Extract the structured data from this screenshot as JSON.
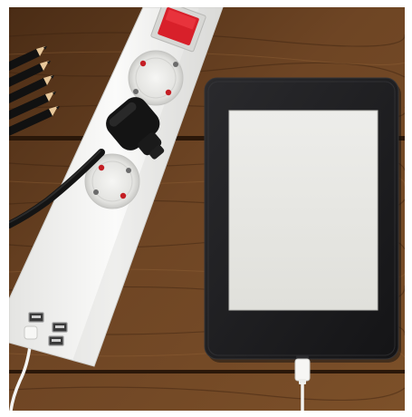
{
  "scene": {
    "subject": "photo",
    "colors": {
      "wood_dark": "#3d2412",
      "wood_mid": "#6b4222",
      "wood_light": "#8a5a30",
      "strip_white": "#f2f2f0",
      "switch_red": "#d8202a",
      "ereader_body": "#1c1c1e",
      "ereader_screen": "#e7e7e2",
      "plug_black": "#141414",
      "pencil_black": "#111111",
      "pencil_tip": "#e8c89a"
    },
    "objects": [
      {
        "name": "power-strip",
        "icon": "power-strip-icon"
      },
      {
        "name": "power-switch",
        "icon": "red-rocker-switch-icon"
      },
      {
        "name": "schuko-socket",
        "icon": "socket-icon",
        "count": 2
      },
      {
        "name": "black-plug",
        "icon": "plug-icon"
      },
      {
        "name": "usb-ports",
        "icon": "usb-port-icon",
        "count": 3
      },
      {
        "name": "pencils",
        "icon": "pencil-icon",
        "count": 5
      },
      {
        "name": "e-reader",
        "icon": "tablet-icon"
      },
      {
        "name": "charging-cables",
        "icon": "usb-cable-icon",
        "count": 2
      }
    ]
  }
}
